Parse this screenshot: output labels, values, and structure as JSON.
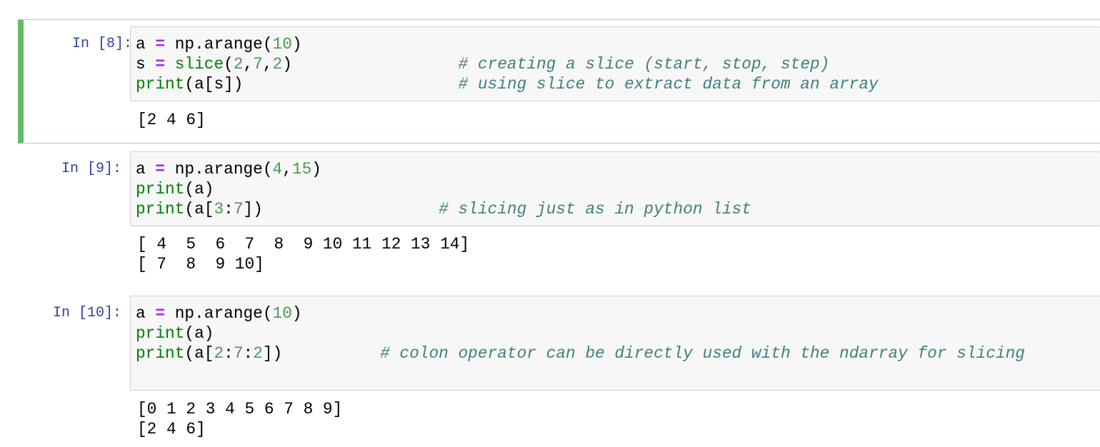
{
  "colors": {
    "selected_border": "#66bb6a",
    "prompt": "#303f9f",
    "operator": "#aa22ff",
    "builtin": "#008000",
    "comment": "#408080"
  },
  "cells": [
    {
      "prompt": "In [8]:",
      "selected": true,
      "code": [
        "a = np.arange(10)",
        "s = slice(2,7,2)                 # creating a slice (start, stop, step)",
        "print(a[s])                      # using slice to extract data from an array"
      ],
      "output": [
        "[2 4 6]"
      ]
    },
    {
      "prompt": "In [9]:",
      "selected": false,
      "code": [
        "a = np.arange(4,15)",
        "print(a)",
        "print(a[3:7])                  # slicing just as in python list"
      ],
      "output": [
        "[ 4  5  6  7  8  9 10 11 12 13 14]",
        "[ 7  8  9 10]"
      ]
    },
    {
      "prompt": "In [10]:",
      "selected": false,
      "code": [
        "a = np.arange(10)",
        "print(a)",
        "print(a[2:7:2])          # colon operator can be directly used with the ndarray for slicing",
        ""
      ],
      "output": [
        "[0 1 2 3 4 5 6 7 8 9]",
        "[2 4 6]"
      ]
    }
  ]
}
